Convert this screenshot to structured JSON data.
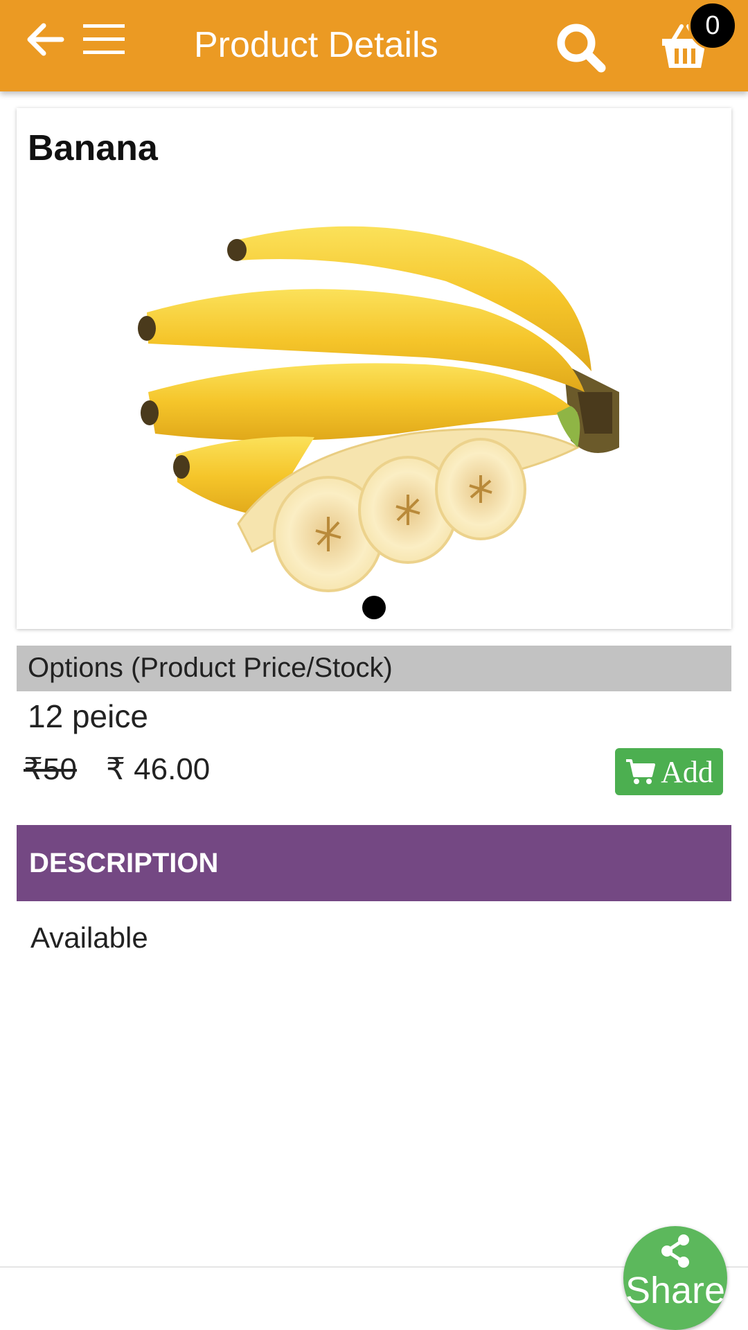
{
  "header": {
    "title": "Product Details",
    "cart_count": "0",
    "back_icon": "arrow-left-icon",
    "menu_icon": "hamburger-menu-icon",
    "search_icon": "search-icon",
    "cart_icon": "basket-icon",
    "background_color": "#eb9a23"
  },
  "product": {
    "name": "Banana",
    "image": "banana-bunch-image",
    "carousel_page_count": 1,
    "carousel_active_index": 0
  },
  "options": {
    "header": "Options (Product Price/Stock)",
    "items": [
      {
        "name": "12 peice",
        "old_price": "₹50",
        "price": "₹ 46.00",
        "add_label": "Add",
        "add_icon": "cart-icon"
      }
    ]
  },
  "description": {
    "header": "DESCRIPTION",
    "text": "Available",
    "header_color": "#744883"
  },
  "share": {
    "label": "Share",
    "icon": "share-icon",
    "color": "#5cb85c"
  }
}
